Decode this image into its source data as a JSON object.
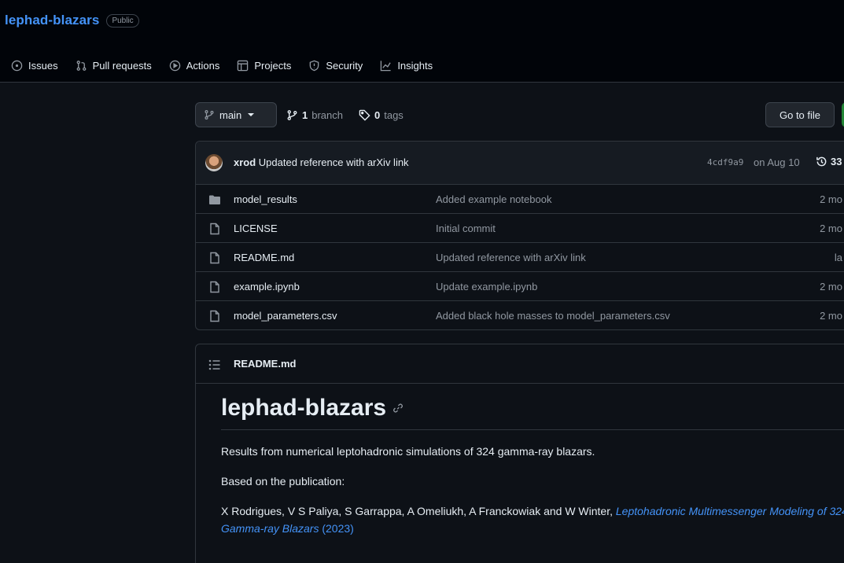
{
  "repo": {
    "name": "lephad-blazars",
    "visibility": "Public"
  },
  "tabs": [
    {
      "label": "Issues",
      "icon": "issue-opened-icon"
    },
    {
      "label": "Pull requests",
      "icon": "git-pull-request-icon"
    },
    {
      "label": "Actions",
      "icon": "play-icon"
    },
    {
      "label": "Projects",
      "icon": "table-icon"
    },
    {
      "label": "Security",
      "icon": "shield-icon"
    },
    {
      "label": "Insights",
      "icon": "graph-icon"
    }
  ],
  "branchbar": {
    "branch": "main",
    "branch_count": "1",
    "branch_label": "branch",
    "tag_count": "0",
    "tag_label": "tags",
    "goto_label": "Go to file"
  },
  "commit": {
    "author": "xrod",
    "message": "Updated reference with arXiv link",
    "hash": "4cdf9a9",
    "date": "on Aug 10",
    "history_count": "33"
  },
  "files": [
    {
      "type": "folder",
      "name": "model_results",
      "message": "Added example notebook",
      "age": "2 mo"
    },
    {
      "type": "file",
      "name": "LICENSE",
      "message": "Initial commit",
      "age": "2 mo"
    },
    {
      "type": "file",
      "name": "README.md",
      "message": "Updated reference with arXiv link",
      "age": "la"
    },
    {
      "type": "file",
      "name": "example.ipynb",
      "message": "Update example.ipynb",
      "age": "2 mo"
    },
    {
      "type": "file",
      "name": "model_parameters.csv",
      "message": "Added black hole masses to model_parameters.csv",
      "age": "2 mo"
    }
  ],
  "readme": {
    "filename": "README.md",
    "title": "lephad-blazars",
    "p1": "Results from numerical leptohadronic simulations of 324 gamma-ray blazars.",
    "p2": "Based on the publication:",
    "authors": "X Rodrigues, V S Paliya, S Garrappa, A Omeliukh, A Franckowiak and W Winter, ",
    "paper_title": "Leptohadronic Multimessenger Modeling of 324 Gamma-ray Blazars",
    "paper_year": " (2023)"
  },
  "colors": {
    "accent": "#4493f8",
    "background": "#0d1117",
    "muted": "#9198a1",
    "code_button": "#238636"
  }
}
